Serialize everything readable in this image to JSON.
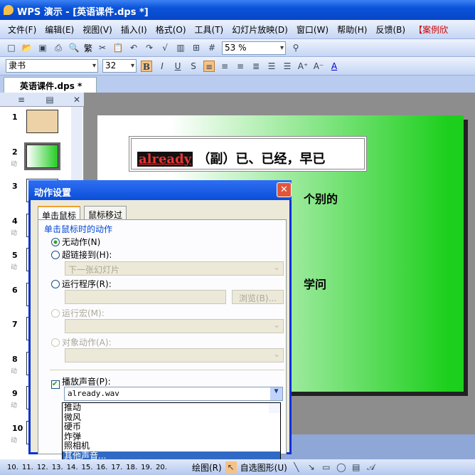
{
  "window": {
    "title": "WPS 演示 - [英语课件.dps *]"
  },
  "menu": [
    "文件(F)",
    "编辑(E)",
    "视图(V)",
    "插入(I)",
    "格式(O)",
    "工具(T)",
    "幻灯片放映(D)",
    "窗口(W)",
    "帮助(H)",
    "反馈(B)",
    "【案例欣"
  ],
  "toolbar": {
    "traditional": "繁",
    "zoom": "53 %",
    "font": "隶书",
    "size": "32",
    "bold": "B",
    "italic": "I",
    "underline": "U",
    "shadow": "S"
  },
  "doc_tab": "英语课件.dps *",
  "slides": [
    {
      "n": "1",
      "anim": ""
    },
    {
      "n": "2",
      "anim": "动"
    },
    {
      "n": "3",
      "anim": ""
    },
    {
      "n": "4",
      "anim": "动"
    },
    {
      "n": "5",
      "anim": "动"
    },
    {
      "n": "6",
      "anim": ""
    },
    {
      "n": "7",
      "anim": ""
    },
    {
      "n": "8",
      "anim": "动"
    },
    {
      "n": "9",
      "anim": "动"
    },
    {
      "n": "10",
      "anim": "动"
    }
  ],
  "slide": {
    "word": "already",
    "meaning": "（副）已、已经，早已",
    "text2": "个别的",
    "text3": "学问"
  },
  "dialog": {
    "title": "动作设置",
    "tabs": [
      "单击鼠标",
      "鼠标移过"
    ],
    "group": "单击鼠标时的动作",
    "none": "无动作(N)",
    "hyperlink": "超链接到(H):",
    "hyperlink_value": "下一张幻灯片",
    "run_program": "运行程序(R):",
    "browse": "浏览(B)...",
    "run_macro": "运行宏(M):",
    "object_action": "对象动作(A):",
    "play_sound": "播放声音(P):",
    "sound_value": "already.wav",
    "sound_options": [
      "推动",
      "微风",
      "硬币",
      "炸弹",
      "照相机",
      "其他声音..."
    ]
  },
  "status": {
    "numbers": [
      "10.",
      "11.",
      "12.",
      "13.",
      "14.",
      "15.",
      "16.",
      "17.",
      "18.",
      "19.",
      "20."
    ],
    "draw": "绘图(R)",
    "autoshapes": "自选图形(U)"
  },
  "colors": {
    "titlebar": "#0a53d8",
    "slide_gradient_end": "#1ccf1c",
    "highlight": "#316ac5"
  }
}
